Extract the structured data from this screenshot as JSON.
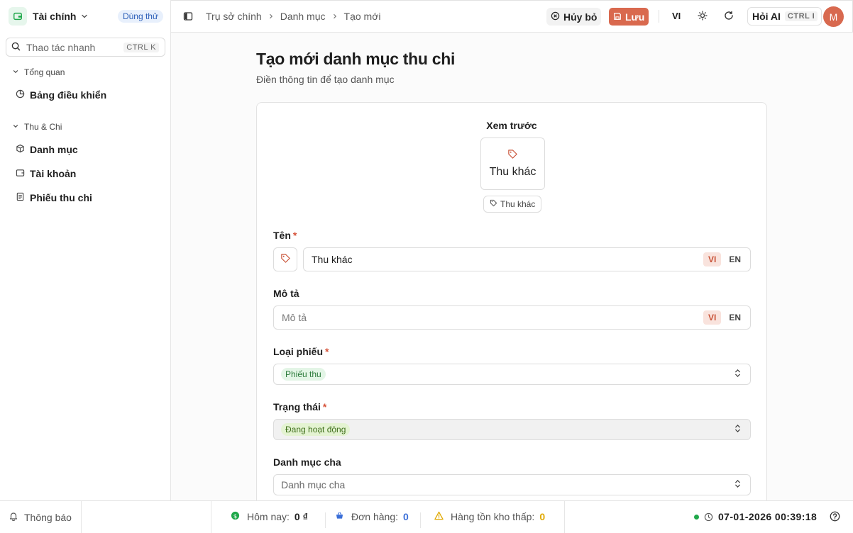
{
  "sidebar": {
    "brand": "Tài chính",
    "trial_badge": "Dùng thử",
    "search_placeholder": "Thao tác nhanh",
    "search_shortcut": "CTRL K",
    "groups": [
      {
        "label": "Tổng quan",
        "items": [
          "Bảng điều khiển"
        ]
      },
      {
        "label": "Thu & Chi",
        "items": [
          "Danh mục",
          "Tài khoản",
          "Phiếu thu chi"
        ]
      }
    ]
  },
  "topbar": {
    "breadcrumb": [
      "Trụ sở chính",
      "Danh mục",
      "Tạo mới"
    ],
    "cancel_label": "Hủy bỏ",
    "save_label": "Lưu",
    "language": "VI",
    "ask_ai_label": "Hỏi AI",
    "ask_ai_shortcut": "CTRL I",
    "avatar_initial": "M"
  },
  "page": {
    "title": "Tạo mới danh mục thu chi",
    "subtitle": "Điền thông tin để tạo danh mục"
  },
  "form": {
    "preview_label": "Xem trước",
    "preview_name": "Thu khác",
    "preview_chip": "Thu khác",
    "name_label": "Tên",
    "name_value": "Thu khác",
    "description_label": "Mô tả",
    "description_placeholder": "Mô tả",
    "lang_vi": "VI",
    "lang_en": "EN",
    "type_label": "Loại phiếu",
    "type_value": "Phiếu thu",
    "status_label": "Trạng thái",
    "status_value": "Đang hoạt động",
    "parent_label": "Danh mục cha",
    "parent_placeholder": "Danh mục cha",
    "required_mark": "*"
  },
  "footer": {
    "notifications_label": "Thông báo",
    "today_label": "Hôm nay:",
    "today_value": "0 ₫",
    "orders_label": "Đơn hàng:",
    "orders_value": "0",
    "low_stock_label": "Hàng tồn kho thấp:",
    "low_stock_value": "0",
    "datetime": "07-01-2026 00:39:18"
  },
  "colors": {
    "accent": "#d9694e",
    "accent_soft": "#f9e3dd",
    "success": "#1fa84a",
    "info": "#2c5fb8",
    "warning": "#e0a800",
    "orders": "#3b6fd8"
  },
  "icons": [
    "wallet-icon",
    "chevron-down-icon",
    "search-icon",
    "pie-chart-icon",
    "box-icon",
    "wallet-account-icon",
    "receipt-icon",
    "sidebar-toggle-icon",
    "chevron-right-icon",
    "x-circle-icon",
    "save-icon",
    "sun-icon",
    "refresh-icon",
    "tag-icon",
    "chevron-updown-icon",
    "bell-icon",
    "dollar-icon",
    "basket-icon",
    "warning-icon",
    "clock-icon",
    "help-icon"
  ]
}
